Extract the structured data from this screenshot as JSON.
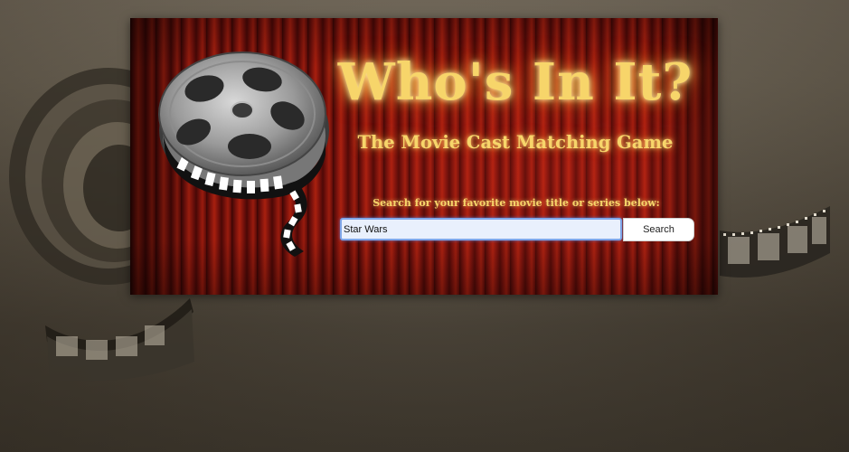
{
  "header": {
    "title": "Who's In It?",
    "subtitle": "The Movie Cast Matching Game"
  },
  "search": {
    "prompt": "Search for your favorite movie title or series below:",
    "value": "Star Wars",
    "button_label": "Search"
  },
  "icons": {
    "logo": "film-reel-icon",
    "background": "film-reel-and-strip-icon"
  },
  "colors": {
    "title_gold": "#f7d56a",
    "curtain_red": "#a8200f",
    "input_focus_blue": "#7fa6e8"
  }
}
